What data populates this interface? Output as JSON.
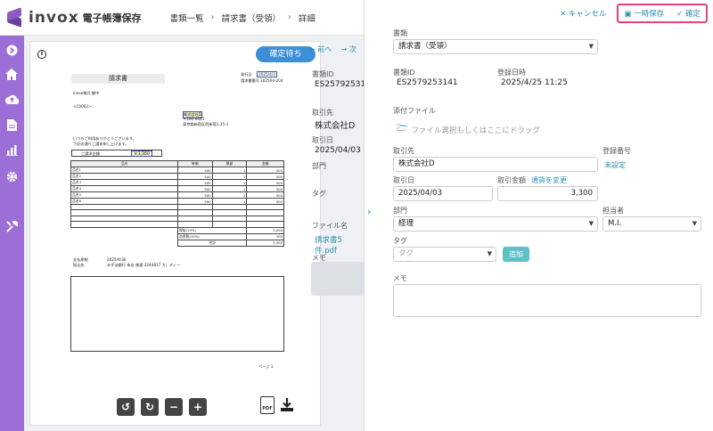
{
  "header": {
    "logo_text": "invox",
    "logo_sub": "電子帳簿保存",
    "breadcrumb": [
      "書類一覧",
      "請求書（受領）",
      "詳細"
    ]
  },
  "sidebar": {
    "icons": [
      "arrow-right-circle-icon",
      "home-icon",
      "cloud-upload-icon",
      "document-icon",
      "chart-icon",
      "gear-icon",
      "tools-icon"
    ]
  },
  "viewer": {
    "status_badge": "確定待ち",
    "info_icon": "i",
    "doc": {
      "title": "請求書",
      "hdr_right1": "発行日",
      "hdr_right1_val": "2025/4/3",
      "hdr_right2": "請求書番号",
      "hdr_right2_val": "202504-204",
      "company": "invox株式 御中",
      "code": "<C0002>",
      "sender_name": "株式会社D",
      "sender_zip": "〒160-0023",
      "sender_addr": "東京都新宿区西新宿1-25-1",
      "greeting1": "いつもご利用ありがとうございます。",
      "greeting2": "下記の通りご請求申し上げます。",
      "amount_label": "ご請求金額",
      "amount_val": "￥3,300",
      "cols": [
        "品名",
        "単価",
        "数量",
        "金額"
      ],
      "rows": [
        [
          "品名1",
          "500",
          "1",
          "500"
        ],
        [
          "品名2",
          "500",
          "1",
          "500"
        ],
        [
          "品名3",
          "500",
          "1",
          "500"
        ],
        [
          "品名4",
          "500",
          "1",
          "500"
        ],
        [
          "品名5",
          "500",
          "1",
          "500"
        ],
        [
          "品名6",
          "500",
          "1",
          "500"
        ]
      ],
      "subtotal_label": "税抜(10%)",
      "subtotal_val": "3,000",
      "tax_label": "消費税(10%)",
      "tax_val": "300",
      "total_label": "合計",
      "total_val": "3,300",
      "pay_label": "支払期限",
      "pay_date": "2025/4/30",
      "bank_label": "振込先",
      "bank_val": "みずほ銀行 本店 普通 3244817 カ）ディー",
      "page": "ページ 1"
    },
    "tools": [
      "rotate-left-icon",
      "rotate-right-icon",
      "zoom-out-icon",
      "zoom-in-icon"
    ],
    "pdf_label": "PDF"
  },
  "mid": {
    "prev": "← 前へ",
    "next": "→ 次",
    "doc_id_label": "書類ID",
    "doc_id": "ES2579253141",
    "partner_label": "取引先",
    "partner": "株式会社D",
    "date_label": "取引日",
    "date": "2025/04/03",
    "dept_label": "部門",
    "tag_label": "タグ",
    "file_label": "ファイル名",
    "file": "請求書5件.pdf",
    "memo_label": "メモ"
  },
  "form": {
    "cancel": "✕ キャンセル",
    "temp_save": "一時保存",
    "confirm": "確定",
    "doctype_label": "書類",
    "doctype": "請求書（受領）",
    "doc_id_label": "書類ID",
    "doc_id": "ES2579253141",
    "reg_label": "登録日時",
    "reg_val": "2025/4/25 11:25",
    "attach_label": "添付ファイル",
    "attach_placeholder": "ファイル選択もしくはここにドラッグ",
    "partner_label": "取引先",
    "partner": "株式会社D",
    "regno_label": "登録番号",
    "regno_val": "未設定",
    "date_label": "取引日",
    "date": "2025/04/03",
    "amount_label": "取引金額",
    "currency_link": "通貨を変更",
    "amount": "3,300",
    "dept_label": "部門",
    "dept": "経理",
    "person_label": "担当者",
    "person": "M.I.",
    "tag_label": "タグ",
    "tag_placeholder": "タグ",
    "add_button": "追加",
    "memo_label": "メモ"
  }
}
